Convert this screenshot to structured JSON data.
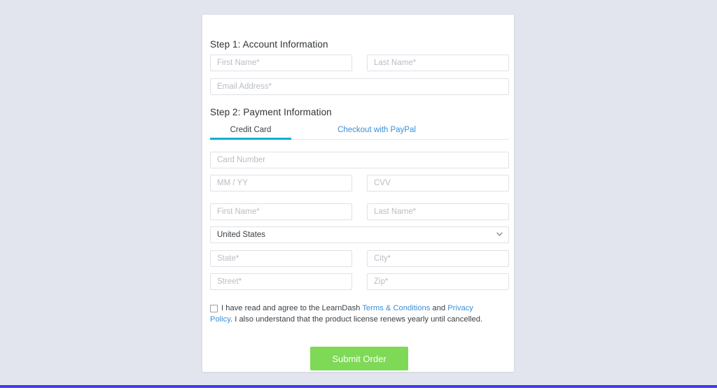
{
  "theme": {
    "page_background": "#e2e5ee",
    "card_background": "#ffffff",
    "accent_tab": "#00b0d3",
    "link_color": "#3b8fd6",
    "submit_color": "#7ed957",
    "bottom_bar_color": "#3b3bea"
  },
  "checkout": {
    "step1": {
      "heading": "Step 1: Account Information",
      "fields": {
        "first_name_placeholder": "First Name*",
        "last_name_placeholder": "Last Name*",
        "email_placeholder": "Email Address*"
      }
    },
    "step2": {
      "heading": "Step 2: Payment Information",
      "tabs": [
        {
          "label": "Credit Card",
          "active": true
        },
        {
          "label": "Checkout with PayPal",
          "active": false
        }
      ],
      "fields": {
        "card_number_placeholder": "Card Number",
        "expiry_placeholder": "MM / YY",
        "cvv_placeholder": "CVV",
        "first_name_placeholder": "First Name*",
        "last_name_placeholder": "Last Name*",
        "country_value": "United States",
        "country_options": [
          "United States"
        ],
        "state_placeholder": "State*",
        "city_placeholder": "City*",
        "street_placeholder": "Street*",
        "zip_placeholder": "Zip*"
      },
      "country_arrow_icon": "chevron-down-icon"
    },
    "terms": {
      "checked": false,
      "text_before": "I have read and agree to the LearnDash ",
      "link_terms": "Terms & Conditions",
      "text_middle": " and ",
      "link_privacy": "Privacy Policy",
      "text_after": ". I also understand that the product license renews yearly until cancelled."
    },
    "submit_label": "Submit Order"
  }
}
